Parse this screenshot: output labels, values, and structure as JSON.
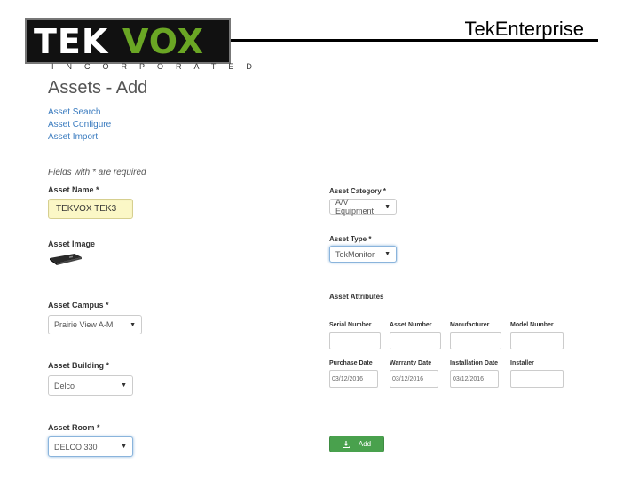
{
  "header": {
    "logo_primary": "TEK",
    "logo_accent": "VOX",
    "logo_tagline": "INCORPORATED",
    "product": "TekEnterprise"
  },
  "page": {
    "title": "Assets - Add"
  },
  "nav_links": [
    "Asset Search",
    "Asset Configure",
    "Asset Import"
  ],
  "form": {
    "required_note": "Fields with * are required",
    "asset_name": {
      "label": "Asset Name *",
      "value": "TEKVOX TEK3"
    },
    "asset_image": {
      "label": "Asset Image"
    },
    "asset_campus": {
      "label": "Asset Campus *",
      "value": "Prairie View A-M"
    },
    "asset_building": {
      "label": "Asset Building *",
      "value": "Delco"
    },
    "asset_room": {
      "label": "Asset Room *",
      "value": "DELCO 330"
    },
    "asset_category": {
      "label": "Asset Category *",
      "value": "A/V Equipment"
    },
    "asset_type": {
      "label": "Asset Type *",
      "value": "TekMonitor"
    },
    "asset_attributes": {
      "label": "Asset Attributes",
      "row1": [
        {
          "label": "Serial Number",
          "value": ""
        },
        {
          "label": "Asset Number",
          "value": ""
        },
        {
          "label": "Manufacturer",
          "value": ""
        },
        {
          "label": "Model Number",
          "value": ""
        }
      ],
      "row2": [
        {
          "label": "Purchase Date",
          "value": "03/12/2016"
        },
        {
          "label": "Warranty Date",
          "value": "03/12/2016"
        },
        {
          "label": "Installation Date",
          "value": "03/12/2016"
        },
        {
          "label": "Installer",
          "value": ""
        }
      ]
    },
    "add_button": {
      "label": "Add",
      "icon": "download-icon"
    }
  },
  "colors": {
    "logo_accent": "#6aa624",
    "link": "#3a7bbf",
    "button": "#49a14d",
    "highlight": "#fbf7c6"
  }
}
